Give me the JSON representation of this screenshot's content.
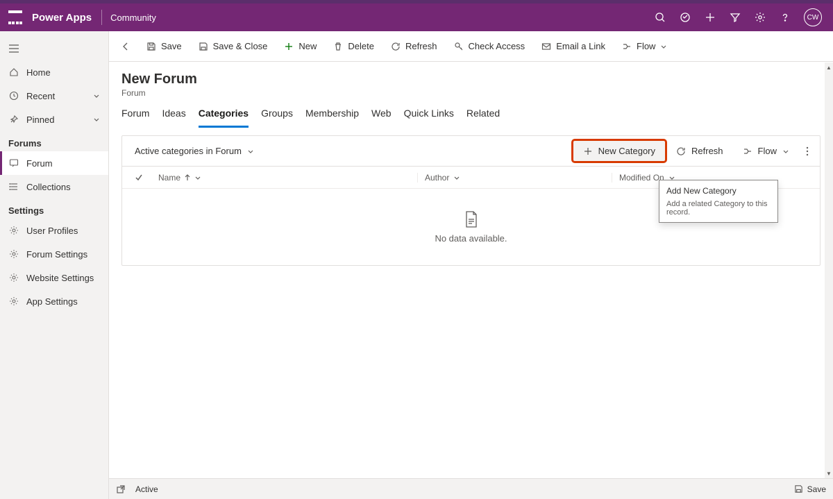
{
  "header": {
    "brand": "Power Apps",
    "area": "Community",
    "avatar_initials": "CW"
  },
  "sidebar": {
    "nav": {
      "home": "Home",
      "recent": "Recent",
      "pinned": "Pinned"
    },
    "sections": {
      "forums": "Forums",
      "settings": "Settings"
    },
    "forums_items": {
      "forum": "Forum",
      "collections": "Collections"
    },
    "settings_items": {
      "user_profiles": "User Profiles",
      "forum_settings": "Forum Settings",
      "website_settings": "Website Settings",
      "app_settings": "App Settings"
    }
  },
  "commands": {
    "save": "Save",
    "save_close": "Save & Close",
    "new": "New",
    "delete": "Delete",
    "refresh": "Refresh",
    "check_access": "Check Access",
    "email_link": "Email a Link",
    "flow": "Flow"
  },
  "page": {
    "title": "New Forum",
    "entity": "Forum"
  },
  "tabs": {
    "forum": "Forum",
    "ideas": "Ideas",
    "categories": "Categories",
    "groups": "Groups",
    "membership": "Membership",
    "web": "Web",
    "quick_links": "Quick Links",
    "related": "Related"
  },
  "grid": {
    "view_name": "Active categories in Forum",
    "actions": {
      "new_category": "New Category",
      "refresh": "Refresh",
      "flow": "Flow"
    },
    "columns": {
      "name": "Name",
      "author": "Author",
      "modified": "Modified On"
    },
    "empty": "No data available."
  },
  "tooltip": {
    "title": "Add New Category",
    "desc": "Add a related Category to this record."
  },
  "footer": {
    "status": "Active",
    "save": "Save"
  }
}
